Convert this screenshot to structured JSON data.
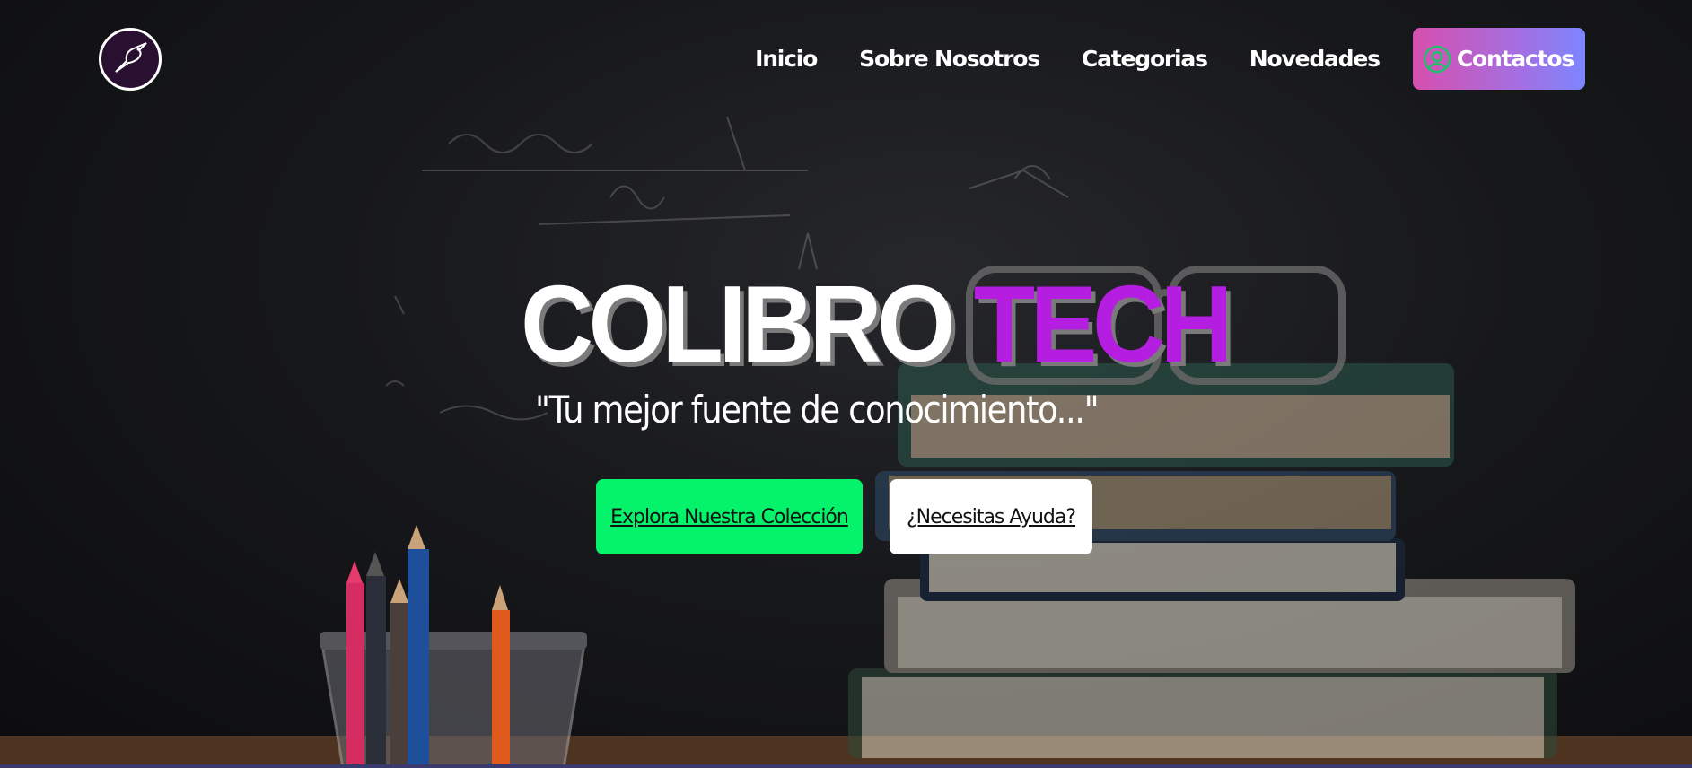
{
  "brand": {
    "logo_icon": "hummingbird-icon"
  },
  "nav": {
    "items": [
      {
        "label": "Inicio"
      },
      {
        "label": "Sobre Nosotros"
      },
      {
        "label": "Categorias"
      },
      {
        "label": "Novedades"
      }
    ],
    "contact": {
      "label": "Contactos",
      "icon": "user-circle-icon"
    }
  },
  "hero": {
    "title_part1": "COLIBRO",
    "title_part2": "TECH",
    "subtitle": "\"Tu mejor fuente de conocimiento...\"",
    "primary_button": "Explora Nuestra Colección",
    "secondary_button": "¿Necesitas Ayuda?"
  },
  "colors": {
    "accent_purple": "#b51de0",
    "primary_green": "#05f26b",
    "contact_gradient_start": "#d64fae",
    "contact_gradient_end": "#7d86ff"
  }
}
